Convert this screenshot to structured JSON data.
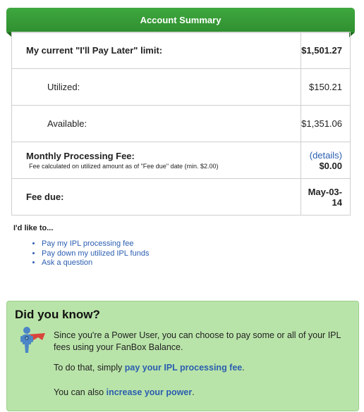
{
  "header": {
    "title": "Account Summary"
  },
  "summary": {
    "limit_label": "My current \"I'll Pay Later\" limit:",
    "limit_value": "$1,501.27",
    "utilized_label": "Utilized:",
    "utilized_value": "$150.21",
    "available_label": "Available:",
    "available_value": "$1,351.06",
    "fee_label": "Monthly Processing Fee:",
    "fee_note": "Fee calculated on utilized amount as of \"Fee due\" date (min. $2.00)",
    "details_link": "(details)",
    "fee_value": "$0.00",
    "due_label": "Fee due:",
    "due_value": "May-03-14"
  },
  "actions": {
    "heading": "I'd like to...",
    "items": [
      "Pay my IPL processing fee",
      "Pay down my utilized IPL funds",
      "Ask a question"
    ]
  },
  "did_you_know": {
    "title": "Did you know?",
    "line1": "Since you're a Power User, you can choose to pay some or all of your IPL fees using your FanBox Balance.",
    "line2_prefix": "To do that, simply ",
    "line2_link": "pay your IPL processing fee",
    "line2_suffix": ".",
    "line3_prefix": "You can also ",
    "line3_link": "increase your power",
    "line3_suffix": ".",
    "icon": "superhero-icon"
  },
  "colors": {
    "header_green": "#2f8f2f",
    "panel_green": "#b9e4a9",
    "link_blue": "#2a5db0"
  }
}
